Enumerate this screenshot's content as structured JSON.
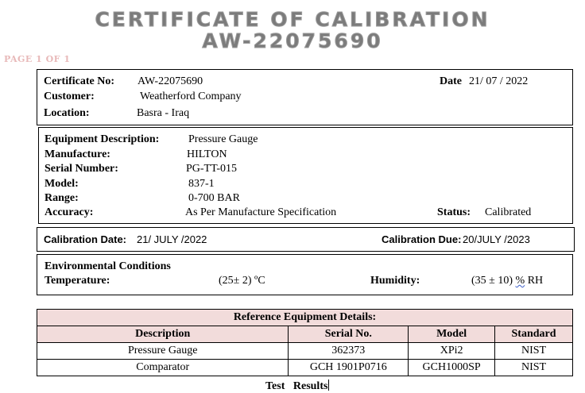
{
  "header": {
    "title_line1": "CERTIFICATE OF CALIBRATION",
    "title_line2": "AW-22075690",
    "page_label": "PAGE 1 OF 1"
  },
  "certificate": {
    "number_label": "Certificate No:",
    "number": "AW-22075690",
    "date_label": "Date",
    "date": "21/ 07 / 2022",
    "customer_label": "Customer:",
    "customer": "Weatherford Company",
    "location_label": "Location:",
    "location": "Basra - Iraq"
  },
  "equipment": {
    "description_label": "Equipment Description:",
    "description": "Pressure Gauge",
    "manufacture_label": "Manufacture:",
    "manufacture": "HILTON",
    "serial_label": "Serial Number:",
    "serial": "PG-TT-015",
    "model_label": "Model:",
    "model": "837-1",
    "range_label": "Range:",
    "range": "0-700 BAR",
    "accuracy_label": "Accuracy:",
    "accuracy": "As Per Manufacture Specification",
    "status_label": "Status:",
    "status": "Calibrated"
  },
  "calibration": {
    "date_label": "Calibration Date:",
    "date": "21/ JULY /2022",
    "due_label": "Calibration Due:",
    "due": "20/JULY /2023"
  },
  "environment": {
    "heading": "Environmental Conditions",
    "temperature_label": "Temperature:",
    "temperature": "(25± 2) ºC",
    "humidity_label": "Humidity:",
    "humidity_value": "(35 ± 10)",
    "humidity_unit_pct": "%",
    "humidity_unit_rh": "RH"
  },
  "reference": {
    "title": "Reference Equipment Details:",
    "columns": [
      "Description",
      "Serial No.",
      "Model",
      "Standard"
    ],
    "rows": [
      [
        "Pressure Gauge",
        "362373",
        "XPi2",
        "NIST"
      ],
      [
        "Comparator",
        "GCH 1901P0716",
        "GCH1000SP",
        "NIST"
      ]
    ]
  },
  "test_results_heading": "Test   Results"
}
